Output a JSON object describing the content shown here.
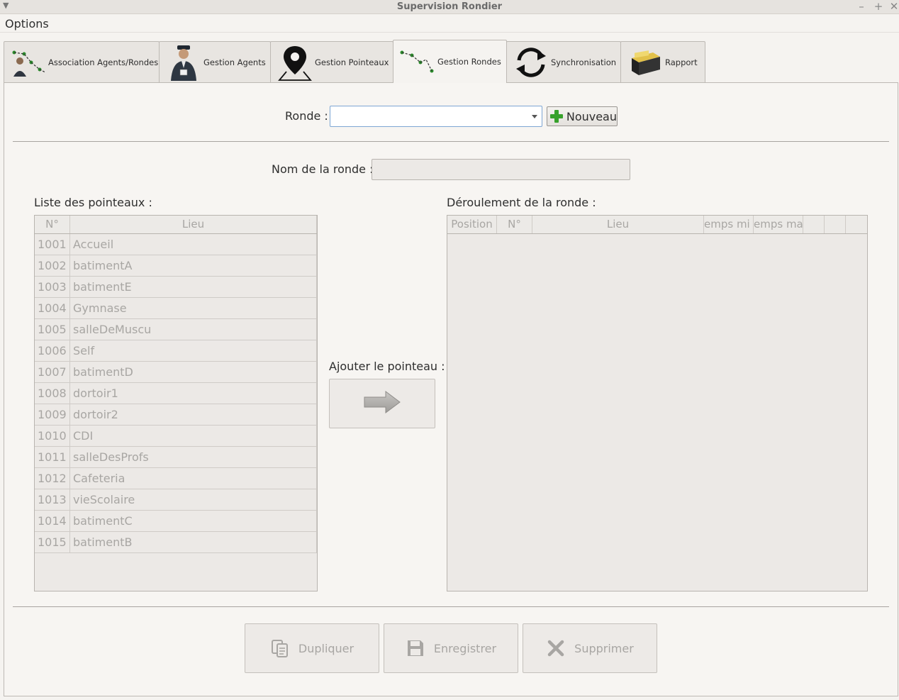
{
  "window": {
    "title": "Supervision Rondier"
  },
  "menu": {
    "options": "Options"
  },
  "tabs": [
    {
      "label": "Association Agents/Rondes",
      "icon": "route-agents-icon"
    },
    {
      "label": "Gestion Agents",
      "icon": "agent-icon"
    },
    {
      "label": "Gestion Pointeaux",
      "icon": "map-pin-icon"
    },
    {
      "label": "Gestion Rondes",
      "icon": "route-icon",
      "active": true
    },
    {
      "label": "Synchronisation",
      "icon": "sync-icon"
    },
    {
      "label": "Rapport",
      "icon": "report-box-icon"
    }
  ],
  "ronde": {
    "label": "Ronde :",
    "value": "",
    "new_button": "Nouveau"
  },
  "nom": {
    "label": "Nom de la ronde :",
    "value": ""
  },
  "liste": {
    "label": "Liste des pointeaux :",
    "columns": [
      "N°",
      "Lieu"
    ],
    "rows": [
      [
        "1001",
        "Accueil"
      ],
      [
        "1002",
        "batimentA"
      ],
      [
        "1003",
        "batimentE"
      ],
      [
        "1004",
        "Gymnase"
      ],
      [
        "1005",
        "salleDeMuscu"
      ],
      [
        "1006",
        "Self"
      ],
      [
        "1007",
        "batimentD"
      ],
      [
        "1008",
        "dortoir1"
      ],
      [
        "1009",
        "dortoir2"
      ],
      [
        "1010",
        "CDI"
      ],
      [
        "1011",
        "salleDesProfs"
      ],
      [
        "1012",
        "Cafeteria"
      ],
      [
        "1013",
        "vieScolaire"
      ],
      [
        "1014",
        "batimentC"
      ],
      [
        "1015",
        "batimentB"
      ]
    ]
  },
  "ajouter": {
    "label": "Ajouter le pointeau :"
  },
  "deroulement": {
    "label": "Déroulement de la ronde :",
    "columns": [
      "Position",
      "N°",
      "Lieu",
      "emps mi",
      "emps ma",
      "",
      "",
      ""
    ]
  },
  "actions": {
    "duplicate": "Dupliquer",
    "save": "Enregistrer",
    "delete": "Supprimer"
  },
  "colors": {
    "accent": "#7ea6d4",
    "add_green": "#37a12b",
    "disabled_text": "#a8a6a3"
  }
}
